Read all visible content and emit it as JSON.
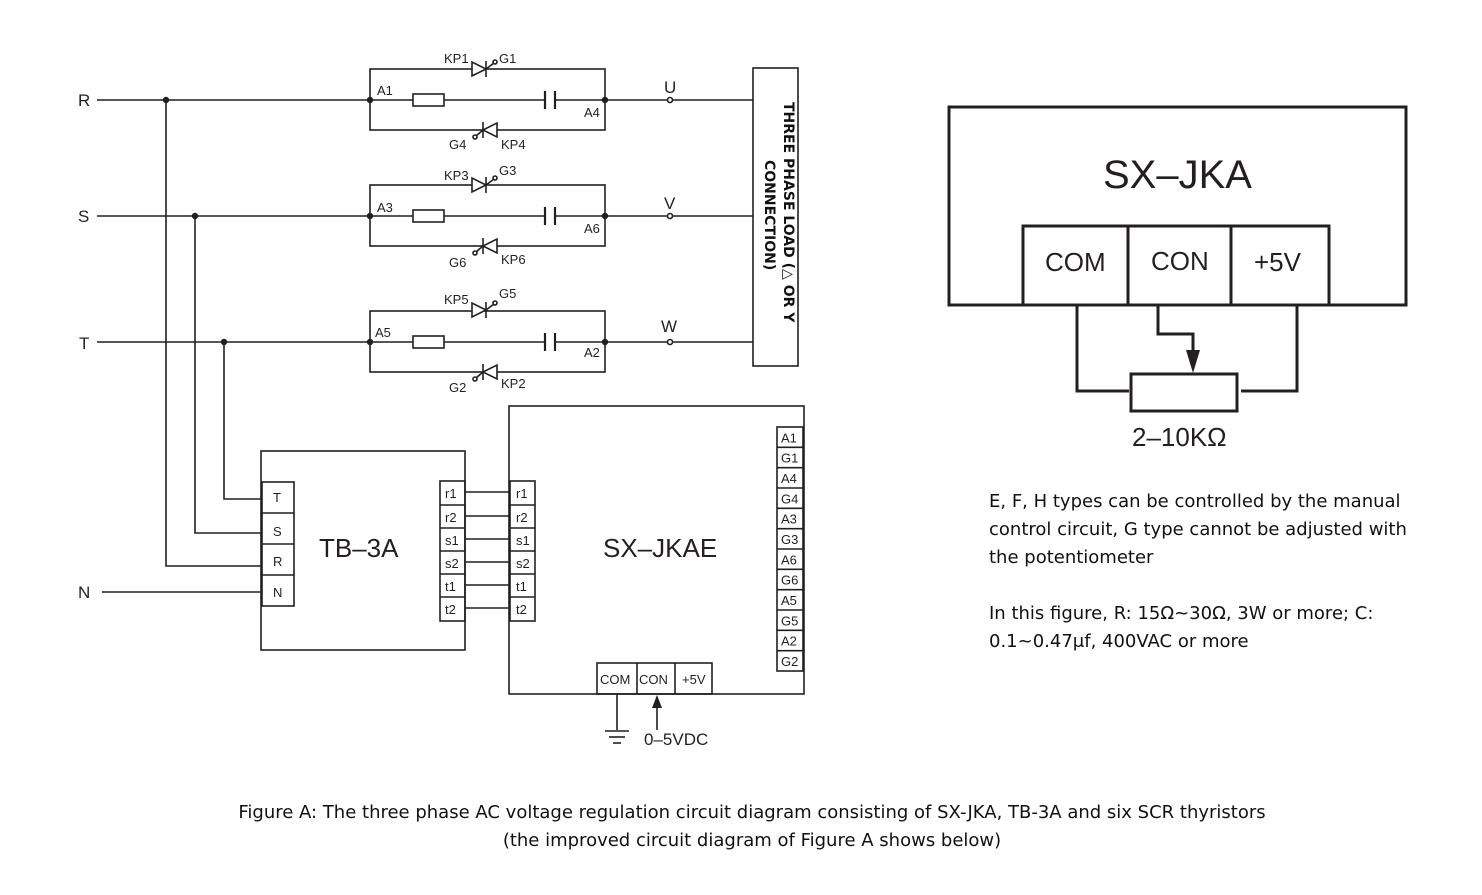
{
  "phases": {
    "R": "R",
    "S": "S",
    "T": "T",
    "N": "N"
  },
  "branches": [
    {
      "in_node": "A1",
      "out_node": "A4",
      "top_scr": "KP1",
      "top_gate": "G1",
      "bot_gate": "G4",
      "bot_scr": "KP4",
      "output": "U"
    },
    {
      "in_node": "A3",
      "out_node": "A6",
      "top_scr": "KP3",
      "top_gate": "G3",
      "bot_gate": "G6",
      "bot_scr": "KP6",
      "output": "V"
    },
    {
      "in_node": "A5",
      "out_node": "A2",
      "top_scr": "KP5",
      "top_gate": "G5",
      "bot_gate": "G2",
      "bot_scr": "KP2",
      "output": "W"
    }
  ],
  "load": {
    "line1": "THREE PHASE LOAD (△ OR Y",
    "line2": "CONNECTION)"
  },
  "tb3a": {
    "title": "TB–3A",
    "inputs": [
      "T",
      "S",
      "R",
      "N"
    ],
    "outputs": [
      "r1",
      "r2",
      "s1",
      "s2",
      "t1",
      "t2"
    ]
  },
  "sxjkae": {
    "title": "SX–JKAE",
    "inputs": [
      "r1",
      "r2",
      "s1",
      "s2",
      "t1",
      "t2"
    ],
    "gate_terminals": [
      "A1",
      "G1",
      "A4",
      "G4",
      "A3",
      "G3",
      "A6",
      "G6",
      "A5",
      "G5",
      "A2",
      "G2"
    ],
    "control_terminals": [
      "COM",
      "CON",
      "+5V"
    ],
    "control_signal": "0–5VDC"
  },
  "sxjka": {
    "title": "SX–JKA",
    "terminals": [
      "COM",
      "CON",
      "+5V"
    ],
    "potentiometer": "2–10KΩ"
  },
  "notes": [
    "E, F, H types can be controlled by the manual control circuit, G type cannot be adjusted with the potentiometer",
    "In this figure, R: 15Ω~30Ω, 3W or more; C: 0.1~0.47μf, 400VAC or more"
  ],
  "caption": {
    "line1": "Figure A: The three phase AC voltage regulation circuit diagram consisting of SX-JKA, TB-3A and six SCR thyristors",
    "line2": "(the improved circuit diagram of Figure A shows below)"
  }
}
